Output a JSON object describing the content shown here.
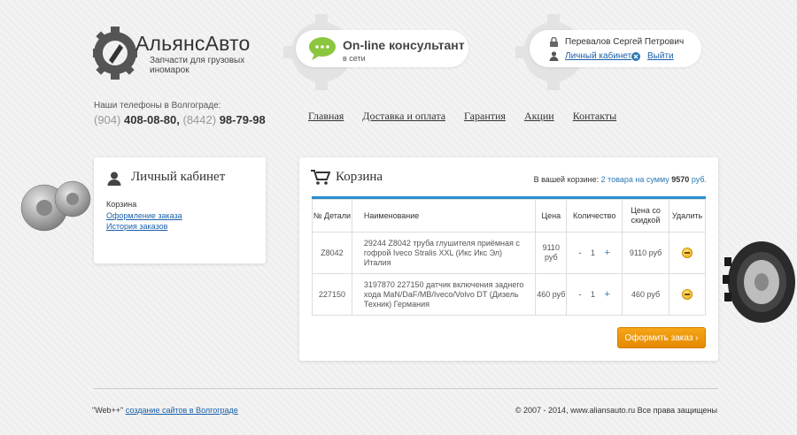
{
  "brand": {
    "name": "АльянсАвто",
    "tagline": "Запчасти для грузовых иномарок"
  },
  "consultant": {
    "title": "On-line консультант",
    "status": "в сети"
  },
  "user": {
    "name": "Перевалов Сергей Петрович",
    "cabinet_link": "Личный кабинет",
    "logout_link": "Выйти"
  },
  "phones": {
    "label": "Наши телефоны в Волгограде:",
    "phone1_code": "(904)",
    "phone1_number": "408-08-80,",
    "phone2_code": "(8442)",
    "phone2_number": "98-79-98"
  },
  "nav": {
    "items": [
      {
        "label": "Главная"
      },
      {
        "label": "Доставка и оплата"
      },
      {
        "label": "Гарантия"
      },
      {
        "label": "Акции"
      },
      {
        "label": "Контакты"
      }
    ]
  },
  "account_panel": {
    "title": "Личный кабинет",
    "current": "Корзина",
    "links": [
      {
        "label": "Оформление заказа"
      },
      {
        "label": "История заказов"
      }
    ]
  },
  "cart": {
    "title": "Корзина",
    "summary_prefix": "В вашей корзине:",
    "summary_count": "2 товара на сумму",
    "summary_total": "9570",
    "summary_currency": "руб.",
    "columns": {
      "number": "№ Детали",
      "name": "Наименование",
      "price": "Цена",
      "quantity": "Количество",
      "discount_price": "Цена со скидкой",
      "delete": "Удалить"
    },
    "rows": [
      {
        "number": "Z8042",
        "name": "29244 Z8042 труба глушителя приёмная с гофрой Iveco Stralis XXL (Икс Икс Эл) Италия",
        "price": "9110 руб",
        "qty_minus": "-",
        "qty": "1",
        "qty_plus": "+",
        "discount_price": "9110 руб"
      },
      {
        "number": "227150",
        "name": "3197870 227150 датчик включения заднего хода MaN/DaF/MB/Iveco/Volvo DT (Дизель Техник) Германия",
        "price": "460 руб",
        "qty_minus": "-",
        "qty": "1",
        "qty_plus": "+",
        "discount_price": "460 руб"
      }
    ],
    "order_button": "Оформить заказ ›"
  },
  "footer": {
    "left_prefix": "\"Web++\"",
    "left_link": "создание сайтов в Волгограде",
    "right": "© 2007 - 2014, www.aliansauto.ru Все права защищены"
  },
  "colors": {
    "accent_blue": "#2b8ed1",
    "order_button": "#f39c12",
    "consultant_green": "#8cc63f",
    "background": "#efefef"
  }
}
